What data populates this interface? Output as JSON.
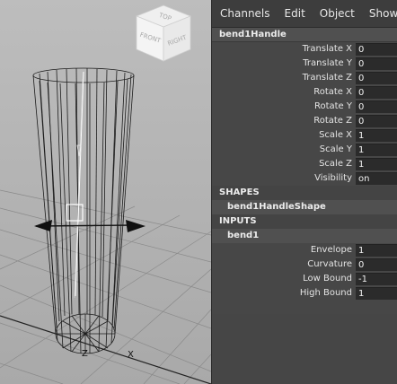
{
  "viewcube": {
    "front_label": "FRONT",
    "right_label": "RIGHT",
    "top_label": "TOP"
  },
  "axes": {
    "z_label": "Z",
    "x_label": "X"
  },
  "menu": {
    "items": [
      "Channels",
      "Edit",
      "Object",
      "Show"
    ]
  },
  "channel_box": {
    "node_name": "bend1Handle",
    "transform_attrs": [
      {
        "label": "Translate X",
        "value": "0"
      },
      {
        "label": "Translate Y",
        "value": "0"
      },
      {
        "label": "Translate Z",
        "value": "0"
      },
      {
        "label": "Rotate X",
        "value": "0"
      },
      {
        "label": "Rotate Y",
        "value": "0"
      },
      {
        "label": "Rotate Z",
        "value": "0"
      },
      {
        "label": "Scale X",
        "value": "1"
      },
      {
        "label": "Scale Y",
        "value": "1"
      },
      {
        "label": "Scale Z",
        "value": "1"
      },
      {
        "label": "Visibility",
        "value": "on"
      }
    ],
    "shapes_header": "SHAPES",
    "shape_name": "bend1HandleShape",
    "inputs_header": "INPUTS",
    "input_name": "bend1",
    "input_attrs": [
      {
        "label": "Envelope",
        "value": "1"
      },
      {
        "label": "Curvature",
        "value": "0"
      },
      {
        "label": "Low Bound",
        "value": "-1"
      },
      {
        "label": "High Bound",
        "value": "1"
      }
    ]
  }
}
